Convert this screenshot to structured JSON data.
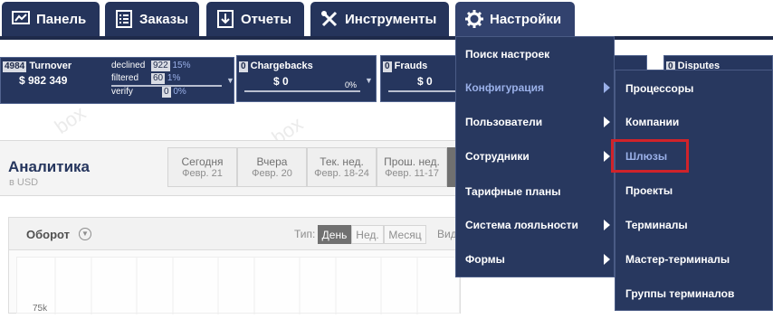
{
  "nav": {
    "tabs": [
      {
        "label": "Панель",
        "icon": "chart-icon"
      },
      {
        "label": "Заказы",
        "icon": "list-icon"
      },
      {
        "label": "Отчеты",
        "icon": "download-icon"
      },
      {
        "label": "Инструменты",
        "icon": "tools-icon"
      },
      {
        "label": "Настройки",
        "icon": "gear-icon"
      }
    ]
  },
  "stats": {
    "turnover": {
      "count": "4984",
      "label": "Turnover",
      "value": "$ 982 349"
    },
    "declined": {
      "label": "declined",
      "count": "922",
      "pct": "15%"
    },
    "filtered": {
      "label": "filtered",
      "count": "60",
      "pct": "1%"
    },
    "verify": {
      "label": "verify",
      "count": "0",
      "pct": "0%"
    },
    "chargebacks": {
      "count": "0",
      "label": "Chargebacks",
      "value": "$ 0",
      "pct": "0%"
    },
    "frauds": {
      "count": "0",
      "label": "Frauds",
      "value": "$ 0"
    },
    "disputes": {
      "count": "0",
      "label": "Disputes"
    }
  },
  "analytics": {
    "title": "Аналитика",
    "currency": "в USD",
    "watermark": "box",
    "periods": [
      {
        "name": "Сегодня",
        "date": "Февр. 21"
      },
      {
        "name": "Вчера",
        "date": "Февр. 20"
      },
      {
        "name": "Тек. нед.",
        "date": "Февр. 18-24"
      },
      {
        "name": "Прош. нед.",
        "date": "Февр. 11-17"
      }
    ],
    "turnover_title": "Оборот",
    "type_label": "Тип:",
    "types": [
      "День",
      "Нед.",
      "Месяц"
    ],
    "view_label": "Вид",
    "y_tick": "75k"
  },
  "menu": {
    "items": [
      "Поиск настроек",
      "Конфигурация",
      "Пользователи",
      "Сотрудники",
      "Тарифные планы",
      "Система лояльности",
      "Формы"
    ],
    "submenu": [
      "Процессоры",
      "Компании",
      "Шлюзы",
      "Проекты",
      "Терминалы",
      "Мастер-терминалы",
      "Группы терминалов"
    ]
  },
  "colors": {
    "nav": "#25345b",
    "menu": "#28385f",
    "highlight": "#d0232a",
    "active_link": "#9ab0e8"
  }
}
